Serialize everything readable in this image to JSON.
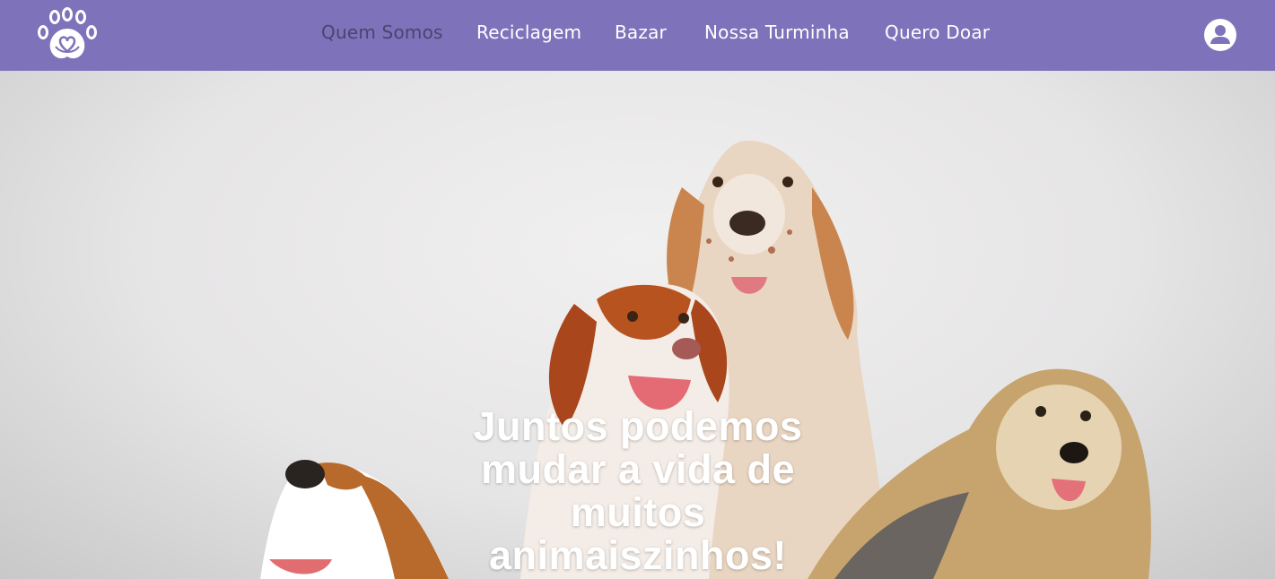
{
  "header": {
    "logo_icon": "paw-heart-logo-icon",
    "nav": [
      {
        "label": "Quem Somos",
        "active": true
      },
      {
        "label": "Reciclagem",
        "active": false
      },
      {
        "label": "Bazar",
        "active": false
      },
      {
        "label": "Nossa Turminha",
        "active": false
      },
      {
        "label": "Quero Doar",
        "active": false
      }
    ],
    "user_icon": "user-account-icon"
  },
  "hero": {
    "image": "dogs-group-photo",
    "headline": "Juntos podemos mudar a vida de muitos animaiszinhos!"
  },
  "colors": {
    "nav_background": "#7e73ba",
    "nav_text": "#ffffff",
    "nav_active_text": "#4a4470",
    "headline": "#ffffff"
  }
}
